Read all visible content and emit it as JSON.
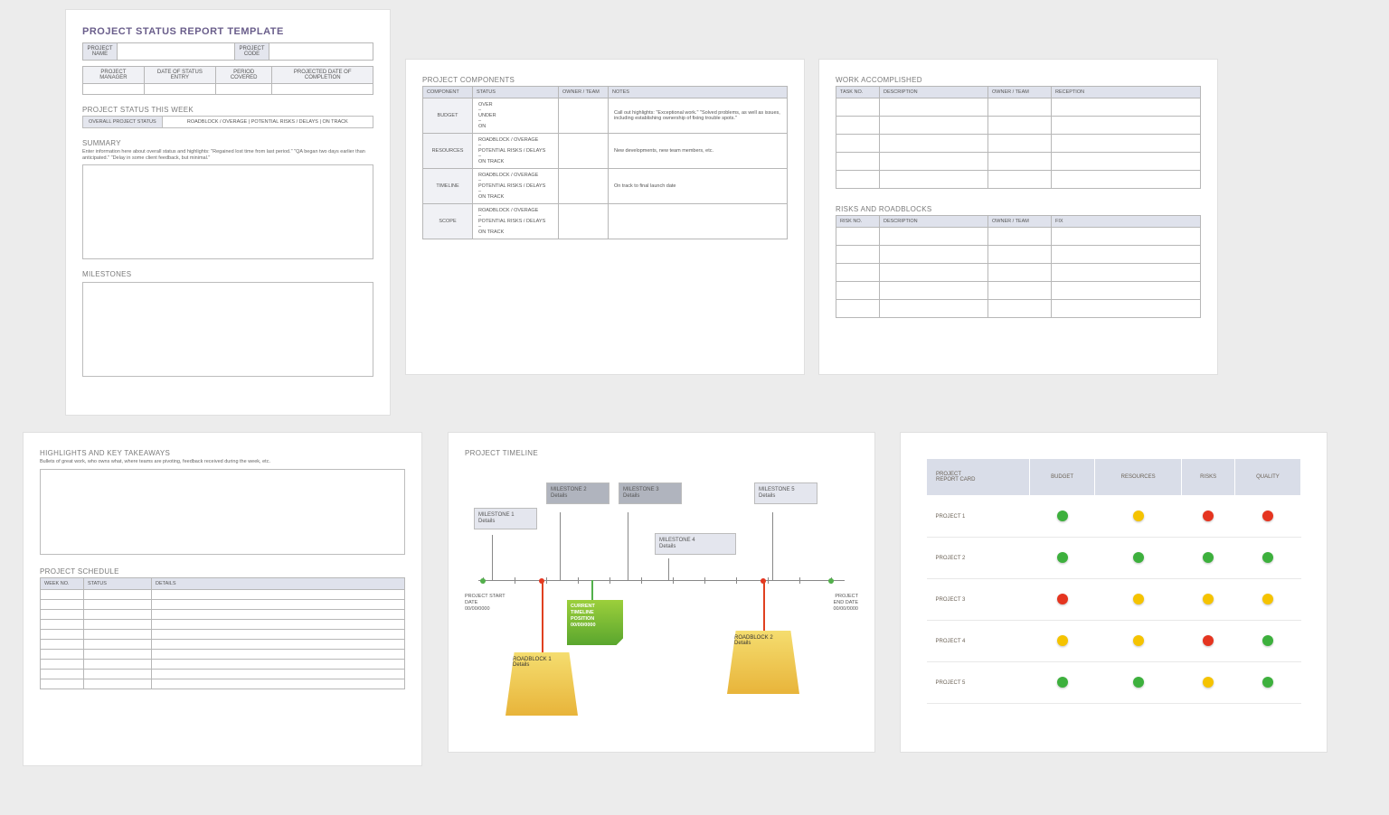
{
  "p1": {
    "title": "PROJECT STATUS REPORT TEMPLATE",
    "info": {
      "name": "PROJECT NAME",
      "code": "PROJECT CODE",
      "mgr": "PROJECT MANAGER",
      "date": "DATE OF STATUS ENTRY",
      "period": "PERIOD COVERED",
      "proj": "PROJECTED DATE OF COMPLETION"
    },
    "status_title": "PROJECT STATUS THIS WEEK",
    "status_label": "OVERALL PROJECT STATUS",
    "status_opts": "ROADBLOCK / OVERAGE    |    POTENTIAL RISKS / DELAYS    |    ON TRACK",
    "summary": "SUMMARY",
    "summary_hint": "Enter information here about overall status and highlights: \"Regained lost time from last period.\" \"QA began two days earlier than anticipated.\" \"Delay in some client feedback, but minimal.\"",
    "milestones": "MILESTONES"
  },
  "p2": {
    "title": "PROJECT COMPONENTS",
    "headers": {
      "c": "COMPONENT",
      "s": "STATUS",
      "o": "OWNER / TEAM",
      "n": "NOTES"
    },
    "rows": {
      "budget": {
        "name": "BUDGET",
        "status": "OVER\n–\nUNDER\n–\nON",
        "notes": "Call out highlights: \"Exceptional work.\" \"Solved problems, as well as issues, including establishing ownership of fixing trouble spots.\""
      },
      "resources": {
        "name": "RESOURCES",
        "status": "ROADBLOCK / OVERAGE\n–\nPOTENTIAL RISKS / DELAYS\n–\nON TRACK",
        "notes": "New developments, new team members, etc."
      },
      "timeline": {
        "name": "TIMELINE",
        "status": "ROADBLOCK / OVERAGE\n–\nPOTENTIAL RISKS / DELAYS\n–\nON TRACK",
        "notes": "On track to final launch date"
      },
      "scope": {
        "name": "SCOPE",
        "status": "ROADBLOCK / OVERAGE\n–\nPOTENTIAL RISKS / DELAYS\n–\nON TRACK",
        "notes": ""
      }
    }
  },
  "p3": {
    "work": {
      "title": "WORK ACCOMPLISHED",
      "h": {
        "a": "TASK NO.",
        "b": "DESCRIPTION",
        "c": "OWNER / TEAM",
        "d": "RECEPTION"
      }
    },
    "risks": {
      "title": "RISKS AND ROADBLOCKS",
      "h": {
        "a": "RISK NO.",
        "b": "DESCRIPTION",
        "c": "OWNER / TEAM",
        "d": "FIX"
      }
    }
  },
  "p4": {
    "title": "HIGHLIGHTS AND KEY TAKEAWAYS",
    "hint": "Bullets of great work, who owns what, where teams are pivoting, feedback received during the week, etc.",
    "sched": "PROJECT SCHEDULE",
    "h": {
      "a": "WEEK NO.",
      "b": "STATUS",
      "c": "DETAILS"
    }
  },
  "p5": {
    "title": "PROJECT TIMELINE",
    "ms": {
      "1": "MILESTONE 1\nDetails",
      "2": "MILESTONE 2\nDetails",
      "3": "MILESTONE 3\nDetails",
      "4": "MILESTONE 4\nDetails",
      "5": "MILESTONE 5\nDetails"
    },
    "rb": {
      "1": "ROADBLOCK 1\nDetails",
      "2": "ROADBLOCK 2\nDetails"
    },
    "cur": "CURRENT\nTIMELINE\nPOSITION\n00/00/0000",
    "start": "PROJECT START\nDATE\n00/00/0000",
    "end": "PROJECT\nEND DATE\n00/00/0000"
  },
  "p6": {
    "h": {
      "a": "PROJECT\nREPORT CARD",
      "b": "BUDGET",
      "c": "RESOURCES",
      "d": "RISKS",
      "e": "QUALITY"
    },
    "rows": [
      {
        "name": "PROJECT 1",
        "c": [
          "g",
          "y",
          "r",
          "r"
        ]
      },
      {
        "name": "PROJECT 2",
        "c": [
          "g",
          "g",
          "g",
          "g"
        ]
      },
      {
        "name": "PROJECT 3",
        "c": [
          "r",
          "y",
          "y",
          "y"
        ]
      },
      {
        "name": "PROJECT 4",
        "c": [
          "y",
          "y",
          "r",
          "g"
        ]
      },
      {
        "name": "PROJECT 5",
        "c": [
          "g",
          "g",
          "y",
          "g"
        ]
      }
    ]
  }
}
